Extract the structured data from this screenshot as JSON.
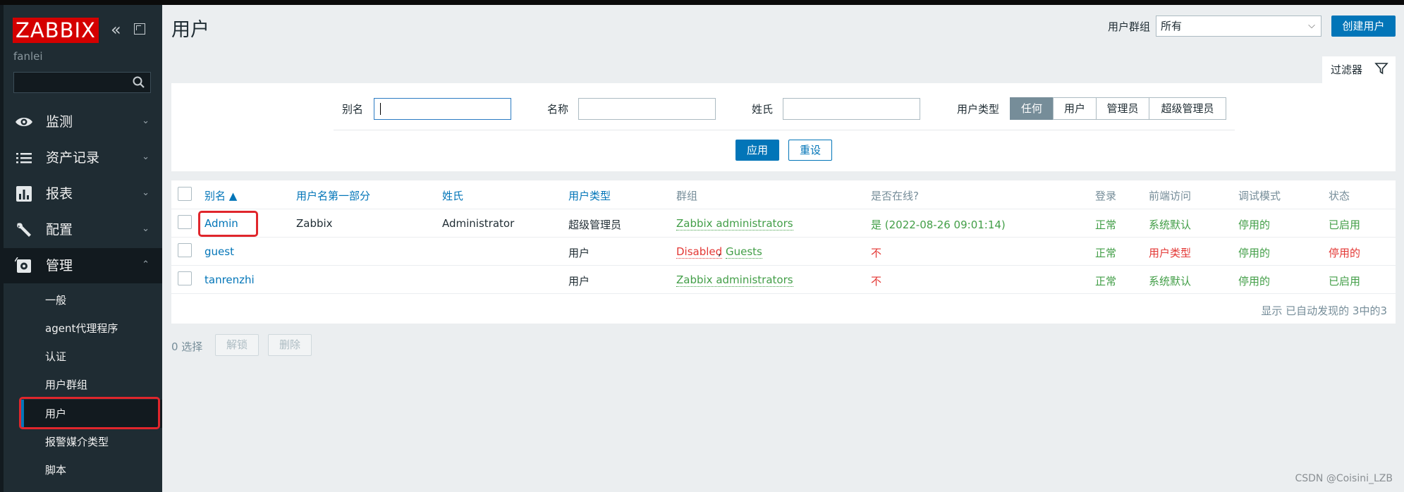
{
  "sidebar": {
    "logo": "ZABBIX",
    "server_name": "fanlei",
    "search_placeholder": "",
    "menu": [
      {
        "label": "监测",
        "icon": "eye-icon"
      },
      {
        "label": "资产记录",
        "icon": "list-icon"
      },
      {
        "label": "报表",
        "icon": "bar-chart-icon"
      },
      {
        "label": "配置",
        "icon": "wrench-icon"
      },
      {
        "label": "管理",
        "icon": "gear-icon"
      }
    ],
    "admin_submenu": [
      "一般",
      "agent代理程序",
      "认证",
      "用户群组",
      "用户",
      "报警媒介类型",
      "脚本"
    ]
  },
  "header": {
    "title": "用户",
    "group_label": "用户群组",
    "group_value": "所有",
    "create_button": "创建用户"
  },
  "filter": {
    "tab_label": "过滤器",
    "alias_label": "别名",
    "alias_value": "",
    "name_label": "名称",
    "name_value": "",
    "surname_label": "姓氏",
    "surname_value": "",
    "type_label": "用户类型",
    "type_options": [
      "任何",
      "用户",
      "管理员",
      "超级管理员"
    ],
    "type_selected": "任何",
    "apply_button": "应用",
    "reset_button": "重设"
  },
  "table": {
    "headers": [
      "别名 ▲",
      "用户名第一部分",
      "姓氏",
      "用户类型",
      "群组",
      "是否在线?",
      "登录",
      "前端访问",
      "调试模式",
      "状态"
    ],
    "rows": [
      {
        "alias": "Admin",
        "name": "Zabbix",
        "surname": "Administrator",
        "type": "超级管理员",
        "groups": [
          "Zabbix administrators"
        ],
        "online": "是 (2022-08-26 09:01:14)",
        "login": "正常",
        "frontend": "系统默认",
        "debug": "停用的",
        "status": "已启用"
      },
      {
        "alias": "guest",
        "name": "",
        "surname": "",
        "type": "用户",
        "groups": [
          "Disabled",
          "Guests"
        ],
        "online": "不",
        "login": "正常",
        "frontend": "用户类型",
        "debug": "停用的",
        "status": "停用的"
      },
      {
        "alias": "tanrenzhi",
        "name": "",
        "surname": "",
        "type": "用户",
        "groups": [
          "Zabbix administrators"
        ],
        "online": "不",
        "login": "正常",
        "frontend": "系统默认",
        "debug": "停用的",
        "status": "已启用"
      }
    ],
    "footer": "显示 已自动发现的 3中的3"
  },
  "actions": {
    "selected_count": "0 选择",
    "unblock_button": "解锁",
    "delete_button": "删除"
  },
  "watermark": "CSDN @Coisini_LZB",
  "colors": {
    "sidebar": "#1f2c33",
    "accent": "#0275b8",
    "green": "#429e47",
    "red": "#e33734",
    "logo_red": "#d40000"
  }
}
